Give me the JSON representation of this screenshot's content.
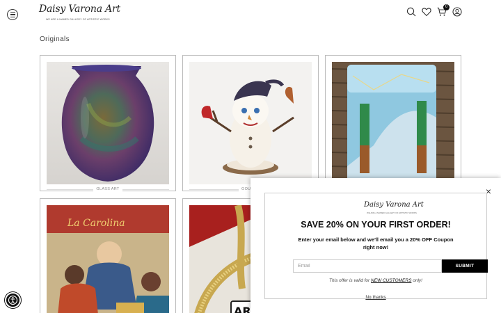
{
  "header": {
    "logo_text": "Daisy Varona Art",
    "logo_tagline": "WE ARE A NAMED GALLERY OF ARTISTIC WORKS",
    "cart_count": "0"
  },
  "section": {
    "title": "Originals"
  },
  "products": [
    {
      "category": "GLASS ART",
      "image": "purple-glass-vase"
    },
    {
      "category": "GOURDS",
      "image": "snowman-gourd-with-cardinals"
    },
    {
      "category": "",
      "image": "glass-art-panel-on-wicker"
    },
    {
      "category": "",
      "image": "cigar-label-collage"
    },
    {
      "category": "",
      "image": "gold-mesh-jewelry"
    }
  ],
  "popup": {
    "logo_text": "Daisy Varona Art",
    "logo_tagline": "WE ARE A NAMED GALLERY OF ARTISTIC WORKS",
    "headline": "SAVE 20% ON YOUR FIRST ORDER!",
    "subtext": "Enter your email below and we'll email you a 20% OFF Coupon right now!",
    "email_placeholder": "Email",
    "submit_label": "SUBMIT",
    "terms_prefix": "This offer is valid for ",
    "terms_link": "NEW CUSTOMERS",
    "terms_suffix": " only!",
    "dismiss_label": "No thanks",
    "close_symbol": "×"
  },
  "partial_texts": {
    "card4_banner": "La Carolina",
    "card5_badge": "AR"
  },
  "icons": [
    "menu-icon",
    "search-icon",
    "heart-icon",
    "cart-icon",
    "account-icon",
    "accessibility-icon",
    "close-icon"
  ]
}
